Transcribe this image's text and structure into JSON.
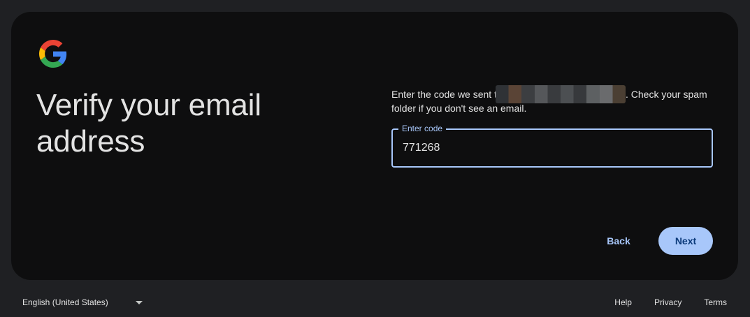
{
  "heading": {
    "title": "Verify your email address"
  },
  "instructions": {
    "before_email": "Enter the code we sent t",
    "after_email": ". Check your spam folder if you don't see an email."
  },
  "code_field": {
    "label": "Enter code",
    "value": "771268"
  },
  "actions": {
    "back_label": "Back",
    "next_label": "Next"
  },
  "footer": {
    "language": "English (United States)",
    "links": [
      "Help",
      "Privacy",
      "Terms"
    ]
  },
  "colors": {
    "accent": "#a8c7fa",
    "card_bg": "#0e0e0f",
    "page_bg": "#1f2023",
    "next_text": "#0b3a7a"
  },
  "icons": {
    "logo": "google-g-logo",
    "language_dropdown": "caret-down-icon"
  }
}
